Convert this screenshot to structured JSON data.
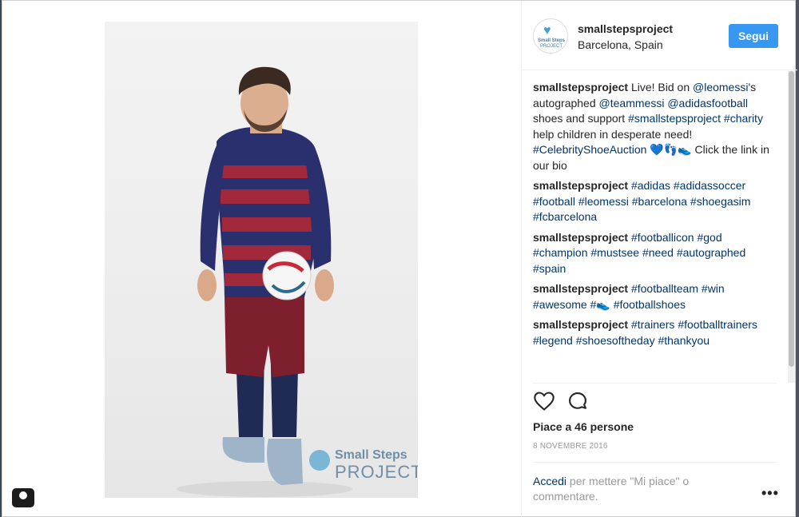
{
  "post": {
    "username": "smallstepsproject",
    "location": "Barcelona, Spain",
    "follow_label": "Segui",
    "avatar_text_1": "Small Steps",
    "avatar_text_2": "PROJECT",
    "watermark_1": "Small Steps",
    "watermark_2": "PROJECT",
    "comments": [
      {
        "user": "smallstepsproject",
        "parts": [
          {
            "t": " Live! Bid on "
          },
          {
            "t": "@leomessi",
            "tag": true
          },
          {
            "t": "'s autographed "
          },
          {
            "t": "@teammessi",
            "tag": true
          },
          {
            "t": " "
          },
          {
            "t": "@adidasfootball",
            "tag": true
          },
          {
            "t": " shoes and support "
          },
          {
            "t": "#smallstepsproject",
            "tag": true
          },
          {
            "t": " "
          },
          {
            "t": "#charity",
            "tag": true
          },
          {
            "t": " help children in desperate need! "
          },
          {
            "t": "#CelebrityShoeAuction",
            "tag": true
          },
          {
            "t": " 💙👣👟 Click the link in our bio"
          }
        ]
      },
      {
        "user": "smallstepsproject",
        "parts": [
          {
            "t": " "
          },
          {
            "t": "#adidas",
            "tag": true
          },
          {
            "t": " "
          },
          {
            "t": "#adidassoccer",
            "tag": true
          },
          {
            "t": " "
          },
          {
            "t": "#football",
            "tag": true
          },
          {
            "t": " "
          },
          {
            "t": "#leomessi",
            "tag": true
          },
          {
            "t": " "
          },
          {
            "t": "#barcelona",
            "tag": true
          },
          {
            "t": " "
          },
          {
            "t": "#shoegasim",
            "tag": true
          },
          {
            "t": " "
          },
          {
            "t": "#fcbarcelona",
            "tag": true
          }
        ]
      },
      {
        "user": "smallstepsproject",
        "parts": [
          {
            "t": " "
          },
          {
            "t": "#footballicon",
            "tag": true
          },
          {
            "t": " "
          },
          {
            "t": "#god",
            "tag": true
          },
          {
            "t": " "
          },
          {
            "t": "#champion",
            "tag": true
          },
          {
            "t": " "
          },
          {
            "t": "#mustsee",
            "tag": true
          },
          {
            "t": " "
          },
          {
            "t": "#need",
            "tag": true
          },
          {
            "t": " "
          },
          {
            "t": "#autographed",
            "tag": true
          },
          {
            "t": " "
          },
          {
            "t": "#spain",
            "tag": true
          }
        ]
      },
      {
        "user": "smallstepsproject",
        "parts": [
          {
            "t": " "
          },
          {
            "t": "#footballteam",
            "tag": true
          },
          {
            "t": " "
          },
          {
            "t": "#win",
            "tag": true
          },
          {
            "t": " "
          },
          {
            "t": "#awesome",
            "tag": true
          },
          {
            "t": " "
          },
          {
            "t": "#👟",
            "tag": true
          },
          {
            "t": " "
          },
          {
            "t": "#footballshoes",
            "tag": true
          }
        ]
      },
      {
        "user": "smallstepsproject",
        "parts": [
          {
            "t": " "
          },
          {
            "t": "#trainers",
            "tag": true
          },
          {
            "t": " "
          },
          {
            "t": "#footballtrainers",
            "tag": true
          },
          {
            "t": " "
          },
          {
            "t": "#legend",
            "tag": true
          },
          {
            "t": " "
          },
          {
            "t": "#shoesoftheday",
            "tag": true
          },
          {
            "t": " "
          },
          {
            "t": "#thankyou",
            "tag": true
          }
        ]
      }
    ],
    "likes_text": "Piace a 46 persone",
    "date_text": "8 NOVEMBRE 2016",
    "login_link": "Accedi",
    "login_rest": " per mettere \"Mi piace\" o commentare.",
    "more_label": "•••"
  },
  "icons": {
    "like": "heart-outline-icon",
    "comment": "speech-bubble-icon",
    "camera": "camera-icon"
  },
  "colors": {
    "accent": "#3897f0",
    "tag": "#003569",
    "muted": "#999999"
  }
}
